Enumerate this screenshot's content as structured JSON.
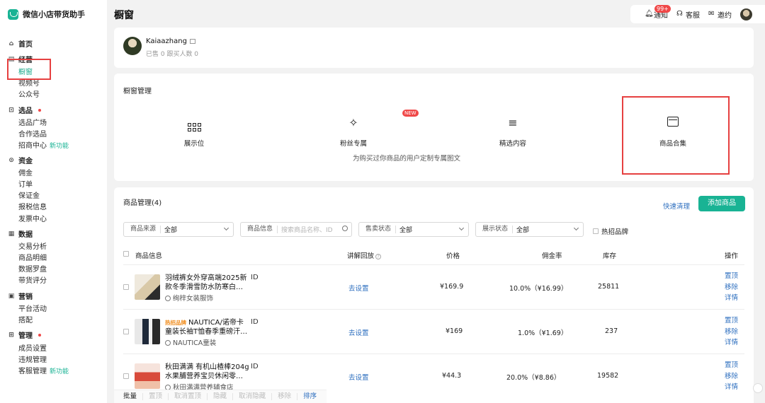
{
  "app": {
    "name": "微信小店带货助手"
  },
  "header": {
    "title": "橱窗",
    "notify_label": "通知",
    "notify_badge": "99+",
    "service_label": "客服",
    "invite_label": "邀约"
  },
  "sidebar": {
    "home": "首页",
    "sec_ops": "经营",
    "showcase": "橱窗",
    "channels": "视频号",
    "official": "公众号",
    "sec_select": "选品",
    "plaza": "选品广场",
    "coop": "合作选品",
    "recruit": "招商中心",
    "new_feature": "新功能",
    "sec_funds": "资金",
    "commission": "佣金",
    "orders": "订单",
    "deposit": "保证金",
    "tax": "报税信息",
    "invoice": "发票中心",
    "sec_data": "数据",
    "trade": "交易分析",
    "product_detail": "商品明细",
    "compass": "数据罗盘",
    "score": "带货评分",
    "sec_marketing": "营销",
    "campaign": "平台活动",
    "match": "搭配",
    "sec_manage": "管理",
    "members": "成员设置",
    "violation": "违规管理",
    "cs_manage": "客服管理",
    "new_feature2": "新功能"
  },
  "profile": {
    "username": "Kaiaazhang",
    "stats": "已售 0   跟买人数 0"
  },
  "showcase": {
    "section_title": "橱窗管理",
    "features": [
      "展示位",
      "粉丝专属",
      "精选内容",
      "商品合集"
    ],
    "new_pill": "NEW",
    "desc": "为购买过你商品的用户定制专属图文"
  },
  "products": {
    "title": "商品管理(4)",
    "quick_clean": "快速清理",
    "add_button": "添加商品",
    "filters": {
      "source_label": "商品来源",
      "source_value": "全部",
      "info_label": "商品信息",
      "info_placeholder": "搜索商品名称、ID",
      "sale_label": "售卖状态",
      "sale_value": "全部",
      "display_label": "展示状态",
      "display_value": "全部",
      "hot_brand": "热招品牌"
    },
    "columns": [
      "商品信息",
      "讲解回放",
      "价格",
      "佣金率",
      "库存",
      "操作"
    ],
    "rows": [
      {
        "name": "羽绒裤女外穿高端2025新款冬季滑雪防水防寒白…",
        "id": "ID",
        "shop": "绚梓女装服饰",
        "replay": "去设置",
        "price": "¥169.9",
        "commission": "10.0%（¥16.99）",
        "stock": "25811"
      },
      {
        "tag": "热招品牌",
        "name": "NAUTICA/诺帝卡童装长袖T恤春季重磅汗…",
        "id": "ID",
        "shop": "NAUTICA童装",
        "replay": "去设置",
        "price": "¥169",
        "commission": "1.0%（¥1.69）",
        "stock": "237"
      },
      {
        "name": "秋田满满 有机山楂棒204g水果脯营养宝贝休闲零…",
        "id": "ID",
        "shop": "秋田满满营养辅食店",
        "replay": "去设置",
        "price": "¥44.3",
        "commission": "20.0%（¥8.86）",
        "stock": "19582"
      }
    ],
    "ops": [
      "置顶",
      "移除",
      "详情"
    ]
  },
  "batch": {
    "label": "批量",
    "actions": [
      "置顶",
      "取消置顶",
      "隐藏",
      "取消隐藏",
      "移除"
    ],
    "sort": "排序"
  },
  "colors": {
    "accent": "#19b394",
    "link": "#2e6fbf",
    "highlight_box": "#e64040"
  }
}
